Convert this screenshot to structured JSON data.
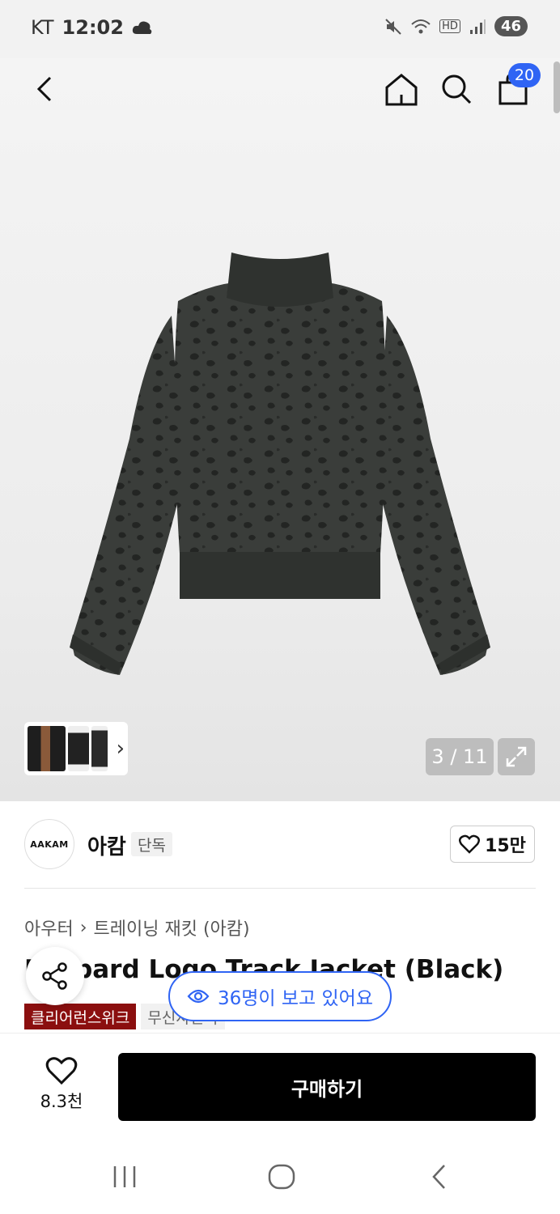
{
  "status_bar": {
    "carrier": "KT",
    "time": "12:02",
    "network": "HD",
    "battery": "46"
  },
  "nav": {
    "cart_count": "20"
  },
  "gallery": {
    "counter": "3 / 11",
    "thumb_more": "›"
  },
  "brand": {
    "logo_text": "AAKAM",
    "name": "아캄",
    "tag": "단독",
    "likes": "15만"
  },
  "product": {
    "breadcrumb": [
      "아우터",
      "트레이닝 재킷 (아캄)"
    ],
    "breadcrumb_sep": "›",
    "title": "Leopard Logo Track Jacket (Black)",
    "badges": [
      "클리어런스위크",
      "무신사단독"
    ],
    "viewers": "36명이 보고 있어요"
  },
  "buybar": {
    "wish_count": "8.3천",
    "buy_label": "구매하기"
  },
  "colors": {
    "accent": "#2f64f4",
    "badge_red": "#8b0f0f",
    "buy_button": "#000000"
  }
}
